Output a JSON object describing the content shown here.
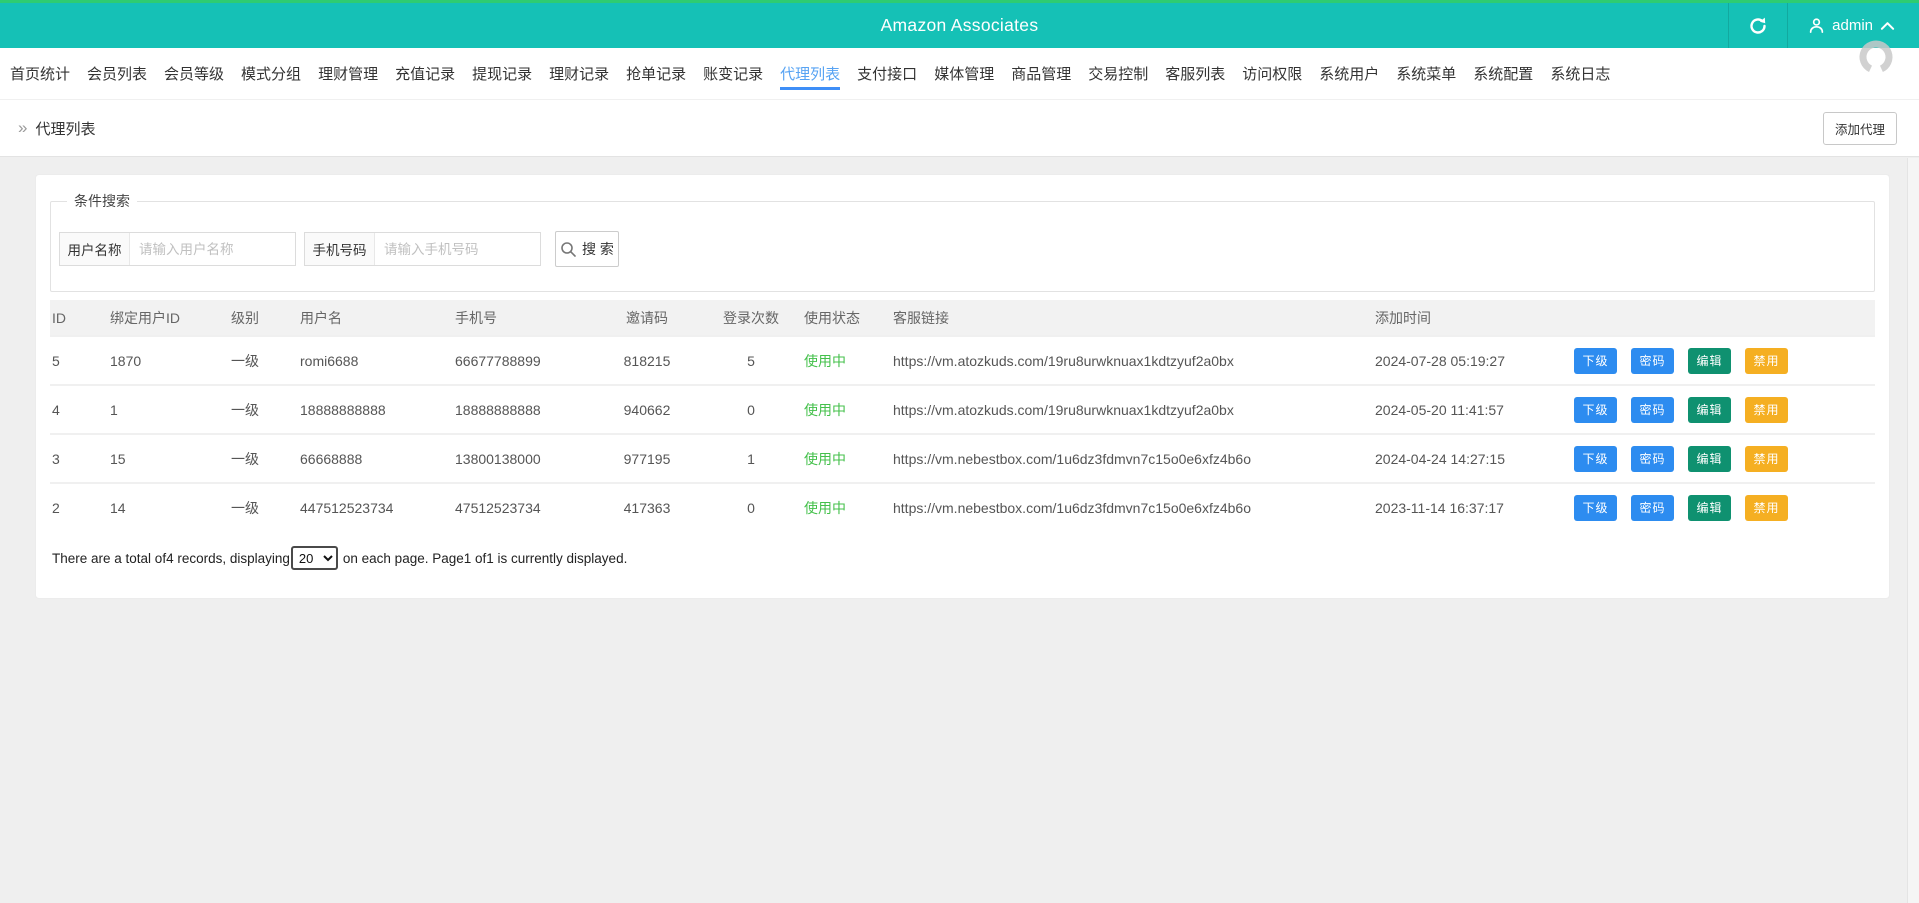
{
  "header": {
    "title": "Amazon Associates",
    "admin": "admin"
  },
  "nav": {
    "active_index": 10,
    "items": [
      "首页统计",
      "会员列表",
      "会员等级",
      "模式分组",
      "理财管理",
      "充值记录",
      "提现记录",
      "理财记录",
      "抢单记录",
      "账变记录",
      "代理列表",
      "支付接口",
      "媒体管理",
      "商品管理",
      "交易控制",
      "客服列表",
      "访问权限",
      "系统用户",
      "系统菜单",
      "系统配置",
      "系统日志"
    ]
  },
  "breadcrumb": {
    "icon": "»",
    "label": "代理列表",
    "add_button": "添加代理"
  },
  "search": {
    "legend": "条件搜索",
    "username_label": "用户名称",
    "username_placeholder": "请输入用户名称",
    "phone_label": "手机号码",
    "phone_placeholder": "请输入手机号码",
    "search_button": "搜 索"
  },
  "table": {
    "columns": [
      "ID",
      "绑定用户ID",
      "级别",
      "用户名",
      "手机号",
      "邀请码",
      "登录次数",
      "使用状态",
      "客服链接",
      "添加时间",
      ""
    ],
    "rows": [
      {
        "id": "5",
        "bind_user_id": "1870",
        "level": "一级",
        "username": "romi6688",
        "phone": "66677788899",
        "invite_code": "818215",
        "login_count": "5",
        "status": "使用中",
        "service_link": "https://vm.atozkuds.com/19ru8urwknuax1kdtzyuf2a0bx",
        "created_at": "2024-07-28 05:19:27"
      },
      {
        "id": "4",
        "bind_user_id": "1",
        "level": "一级",
        "username": "18888888888",
        "phone": "18888888888",
        "invite_code": "940662",
        "login_count": "0",
        "status": "使用中",
        "service_link": "https://vm.atozkuds.com/19ru8urwknuax1kdtzyuf2a0bx",
        "created_at": "2024-05-20 11:41:57"
      },
      {
        "id": "3",
        "bind_user_id": "15",
        "level": "一级",
        "username": "66668888",
        "phone": "13800138000",
        "invite_code": "977195",
        "login_count": "1",
        "status": "使用中",
        "service_link": "https://vm.nebestbox.com/1u6dz3fdmvn7c15o0e6xfz4b6o",
        "created_at": "2024-04-24 14:27:15"
      },
      {
        "id": "2",
        "bind_user_id": "14",
        "level": "一级",
        "username": "447512523734",
        "phone": "47512523734",
        "invite_code": "417363",
        "login_count": "0",
        "status": "使用中",
        "service_link": "https://vm.nebestbox.com/1u6dz3fdmvn7c15o0e6xfz4b6o",
        "created_at": "2023-11-14 16:37:17"
      }
    ],
    "row_actions": [
      {
        "label": "下级",
        "name": "sublevel-button",
        "color": "#2d8cf0"
      },
      {
        "label": "密码",
        "name": "password-button",
        "color": "#2d8cf0"
      },
      {
        "label": "编辑",
        "name": "edit-button",
        "color": "#0f9170"
      },
      {
        "label": "禁用",
        "name": "disable-button",
        "color": "#f5af22"
      }
    ]
  },
  "pagination": {
    "text_before": "There are a total of4 records, displaying",
    "page_size": "20",
    "text_after": "on each page. Page1 of1 is currently displayed."
  },
  "colors": {
    "header_teal": "#15c1b6",
    "top_accent_green": "#2ecc71",
    "active_nav_blue": "#3e8ef7",
    "status_green": "#44c04b",
    "button_blue": "#2d8cf0",
    "button_green": "#0f9170",
    "button_amber": "#f5af22"
  }
}
